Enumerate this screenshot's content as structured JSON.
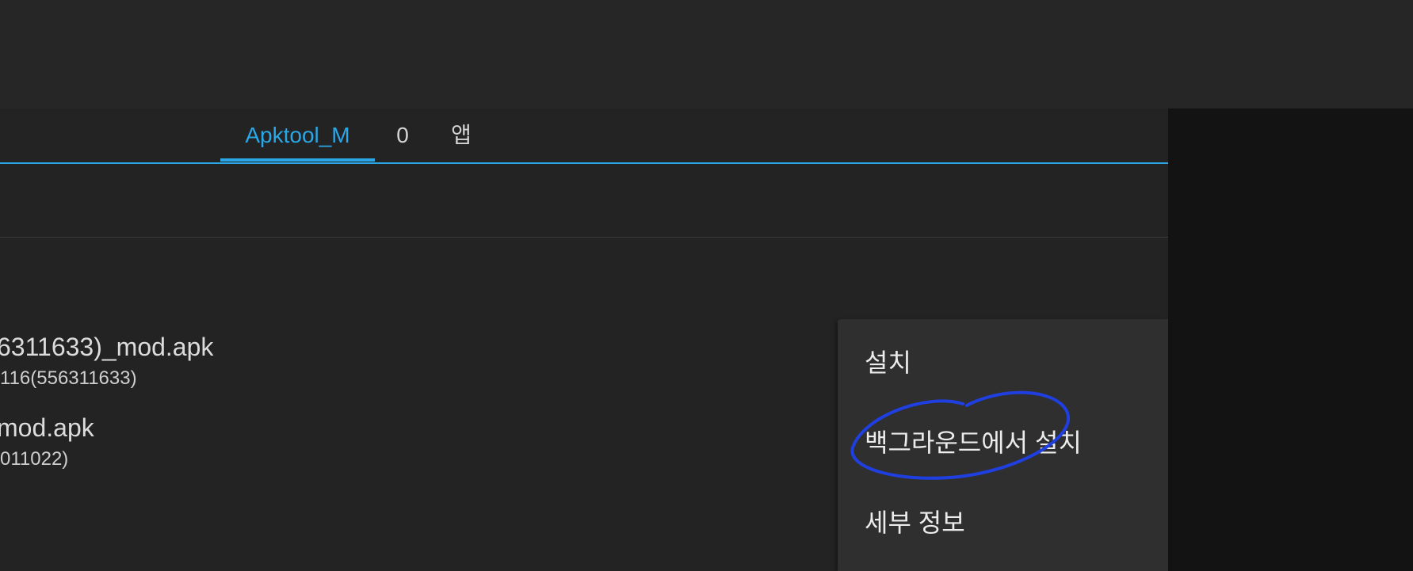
{
  "tabs": [
    {
      "label": "Apktool_M",
      "active": true
    },
    {
      "label": "0",
      "active": false
    },
    {
      "label": "앱",
      "active": false
    }
  ],
  "files": [
    {
      "name": "6311633)_mod.apk",
      "subtitle": "116(556311633)"
    },
    {
      "name": "mod.apk",
      "subtitle": "011022)"
    }
  ],
  "context_menu": {
    "items": [
      {
        "label": "설치"
      },
      {
        "label": "백그라운드에서 설치"
      },
      {
        "label": "세부 정보"
      }
    ]
  },
  "colors": {
    "accent": "#2aa7e6",
    "annotation": "#1f3fe0",
    "background": "#232323",
    "menu_background": "#2f2f2f"
  }
}
